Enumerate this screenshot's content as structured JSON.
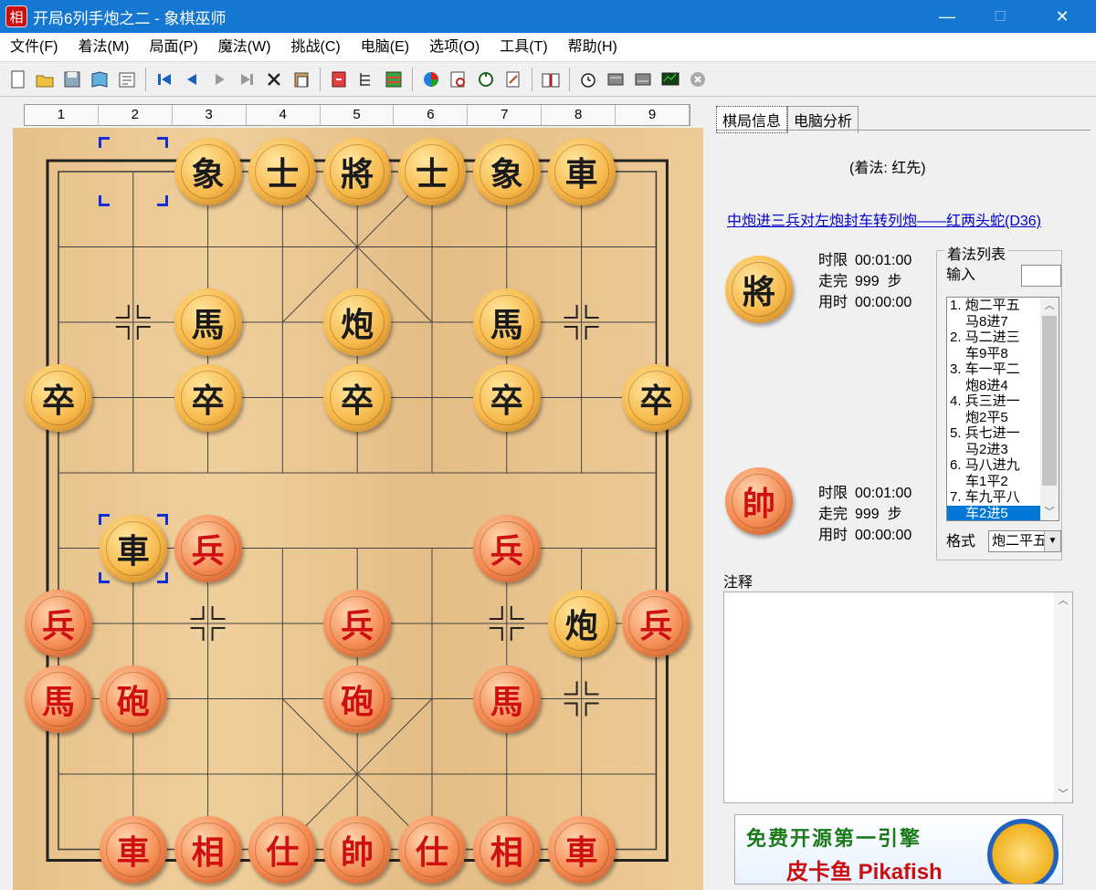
{
  "window": {
    "app_icon_char": "相",
    "title": "开局6列手炮之二 - 象棋巫师",
    "min_glyph": "—",
    "max_glyph": "☐",
    "close_glyph": "✕"
  },
  "menu": [
    "文件(F)",
    "着法(M)",
    "局面(P)",
    "魔法(W)",
    "挑战(C)",
    "电脑(E)",
    "选项(O)",
    "工具(T)",
    "帮助(H)"
  ],
  "toolbar_icons": [
    "new-file-icon",
    "open-folder-icon",
    "save-icon",
    "book-icon",
    "properties-icon",
    "sep",
    "first-move-icon",
    "prev-move-icon",
    "next-move-icon",
    "last-move-icon",
    "delete-icon",
    "paste-icon",
    "sep",
    "flip-board-icon",
    "tree-icon",
    "table-icon",
    "sep",
    "color-wheel-icon",
    "search-icon",
    "cycle-icon",
    "edit-icon",
    "sep",
    "open-book-icon",
    "sep",
    "clock-icon",
    "engine-icon",
    "engine2-icon",
    "monitor-icon",
    "stop-icon"
  ],
  "board": {
    "columns": [
      "1",
      "2",
      "3",
      "4",
      "5",
      "6",
      "7",
      "8",
      "9"
    ],
    "pieces": [
      {
        "ch": "象",
        "side": "black",
        "file": 2,
        "rank": 0
      },
      {
        "ch": "士",
        "side": "black",
        "file": 3,
        "rank": 0
      },
      {
        "ch": "將",
        "side": "black",
        "file": 4,
        "rank": 0
      },
      {
        "ch": "士",
        "side": "black",
        "file": 5,
        "rank": 0
      },
      {
        "ch": "象",
        "side": "black",
        "file": 6,
        "rank": 0
      },
      {
        "ch": "車",
        "side": "black",
        "file": 7,
        "rank": 0
      },
      {
        "ch": "馬",
        "side": "black",
        "file": 2,
        "rank": 2
      },
      {
        "ch": "炮",
        "side": "black",
        "file": 4,
        "rank": 2
      },
      {
        "ch": "馬",
        "side": "black",
        "file": 6,
        "rank": 2
      },
      {
        "ch": "卒",
        "side": "black",
        "file": 0,
        "rank": 3
      },
      {
        "ch": "卒",
        "side": "black",
        "file": 2,
        "rank": 3
      },
      {
        "ch": "卒",
        "side": "black",
        "file": 4,
        "rank": 3
      },
      {
        "ch": "卒",
        "side": "black",
        "file": 6,
        "rank": 3
      },
      {
        "ch": "卒",
        "side": "black",
        "file": 8,
        "rank": 3
      },
      {
        "ch": "車",
        "side": "black",
        "file": 1,
        "rank": 5
      },
      {
        "ch": "兵",
        "side": "red",
        "file": 2,
        "rank": 5
      },
      {
        "ch": "兵",
        "side": "red",
        "file": 6,
        "rank": 5
      },
      {
        "ch": "兵",
        "side": "red",
        "file": 0,
        "rank": 6
      },
      {
        "ch": "兵",
        "side": "red",
        "file": 4,
        "rank": 6
      },
      {
        "ch": "炮",
        "side": "black",
        "file": 7,
        "rank": 6
      },
      {
        "ch": "兵",
        "side": "red",
        "file": 8,
        "rank": 6
      },
      {
        "ch": "馬",
        "side": "red",
        "file": 0,
        "rank": 7
      },
      {
        "ch": "砲",
        "side": "red",
        "file": 1,
        "rank": 7
      },
      {
        "ch": "砲",
        "side": "red",
        "file": 4,
        "rank": 7
      },
      {
        "ch": "馬",
        "side": "red",
        "file": 6,
        "rank": 7
      },
      {
        "ch": "車",
        "side": "red",
        "file": 1,
        "rank": 9
      },
      {
        "ch": "相",
        "side": "red",
        "file": 2,
        "rank": 9
      },
      {
        "ch": "仕",
        "side": "red",
        "file": 3,
        "rank": 9
      },
      {
        "ch": "帥",
        "side": "red",
        "file": 4,
        "rank": 9
      },
      {
        "ch": "仕",
        "side": "red",
        "file": 5,
        "rank": 9
      },
      {
        "ch": "相",
        "side": "red",
        "file": 6,
        "rank": 9
      },
      {
        "ch": "車",
        "side": "red",
        "file": 7,
        "rank": 9
      }
    ],
    "last_move": {
      "from": {
        "file": 1,
        "rank": 0
      },
      "to": {
        "file": 1,
        "rank": 5
      }
    },
    "empty_markers": [
      {
        "file": 1,
        "rank": 2
      },
      {
        "file": 7,
        "rank": 2
      },
      {
        "file": 2,
        "rank": 6
      },
      {
        "file": 6,
        "rank": 6
      },
      {
        "file": 7,
        "rank": 7
      }
    ]
  },
  "panel": {
    "tabs": [
      "棋局信息",
      "电脑分析"
    ],
    "move_order": "(着法: 红先)",
    "opening_name": "中炮进三兵对左炮封车转列炮——红两头蛇(D36)",
    "black": {
      "piece": "將",
      "time_limit_label": "时限",
      "time_limit": "00:01:00",
      "moves_label": "走完",
      "moves": "999",
      "moves_unit": "步",
      "used_label": "用时",
      "used": "00:00:00"
    },
    "red": {
      "piece": "帥",
      "time_limit_label": "时限",
      "time_limit": "00:01:00",
      "moves_label": "走完",
      "moves": "999",
      "moves_unit": "步",
      "used_label": "用时",
      "used": "00:00:00"
    },
    "movelist": {
      "title": "着法列表",
      "input_label": "输入",
      "moves": [
        "1. 炮二平五",
        "马8进7",
        "2. 马二进三",
        "车9平8",
        "3. 车一平二",
        "炮8进4",
        "4. 兵三进一",
        "炮2平5",
        "5. 兵七进一",
        "马2进3",
        "6. 马八进九",
        "车1平2",
        "7. 车九平八",
        "车2进5"
      ],
      "selected_index": 13,
      "format_label": "格式",
      "format_value": "炮二平五"
    },
    "notes_label": "注释",
    "ad": {
      "line1": "免费开源第一引擎",
      "line2": "皮卡鱼 Pikafish"
    }
  }
}
